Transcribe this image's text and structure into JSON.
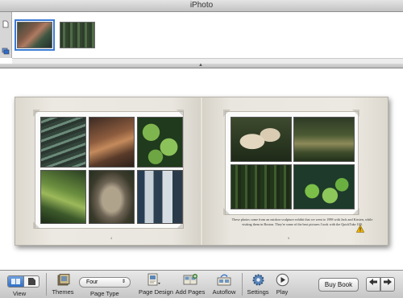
{
  "window": {
    "title": "iPhoto"
  },
  "book": {
    "caption": "These photos come from an outdoor sculpture exhibit that we went to 1998 with Jack and Kirsten, while visiting them in Boston. They're some of the best pictures I took with the QuickTake 100.",
    "left_page_number": "4",
    "right_page_number": "5"
  },
  "toolbar": {
    "view_label": "View",
    "themes_label": "Themes",
    "page_type_value": "Four",
    "page_type_label": "Page Type",
    "page_design_label": "Page Design",
    "add_pages_label": "Add Pages",
    "autoflow_label": "Autoflow",
    "settings_label": "Settings",
    "play_label": "Play",
    "buy_book_label": "Buy Book"
  },
  "icons": {
    "prev": "arrow-left-icon",
    "next": "arrow-right-icon"
  },
  "colors": {
    "selection": "#3b7bd6",
    "warning": "#f0b400"
  }
}
